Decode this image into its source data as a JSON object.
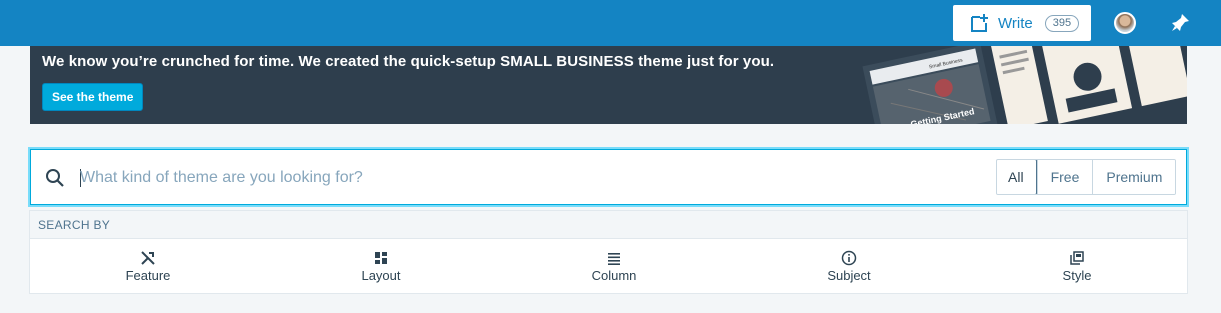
{
  "masterbar": {
    "write_label": "Write",
    "draft_count": "395",
    "icons": [
      "write-icon",
      "avatar",
      "notifications-bell-icon"
    ]
  },
  "banner": {
    "text_before": "We know you’re crunched for time. We created the quick-setup ",
    "text_strong": "SMALL BUSINESS",
    "text_after": " theme just for you.",
    "button_label": "See the theme",
    "art_caption": "Small Business",
    "art_headline": "Getting Started"
  },
  "search": {
    "placeholder": "What kind of theme are you looking for?",
    "value": "",
    "tiers": [
      "All",
      "Free",
      "Premium"
    ],
    "selected_tier": "All"
  },
  "search_by": {
    "heading": "SEARCH BY",
    "filters": [
      {
        "label": "Feature",
        "icon": "tools-icon"
      },
      {
        "label": "Layout",
        "icon": "layout-icon"
      },
      {
        "label": "Column",
        "icon": "column-icon"
      },
      {
        "label": "Subject",
        "icon": "info-icon"
      },
      {
        "label": "Style",
        "icon": "style-icon"
      }
    ]
  },
  "colors": {
    "masterbar": "#1484c3",
    "banner": "#2e3e4d",
    "accent": "#00aadc",
    "focus_border": "#78dcfa"
  }
}
